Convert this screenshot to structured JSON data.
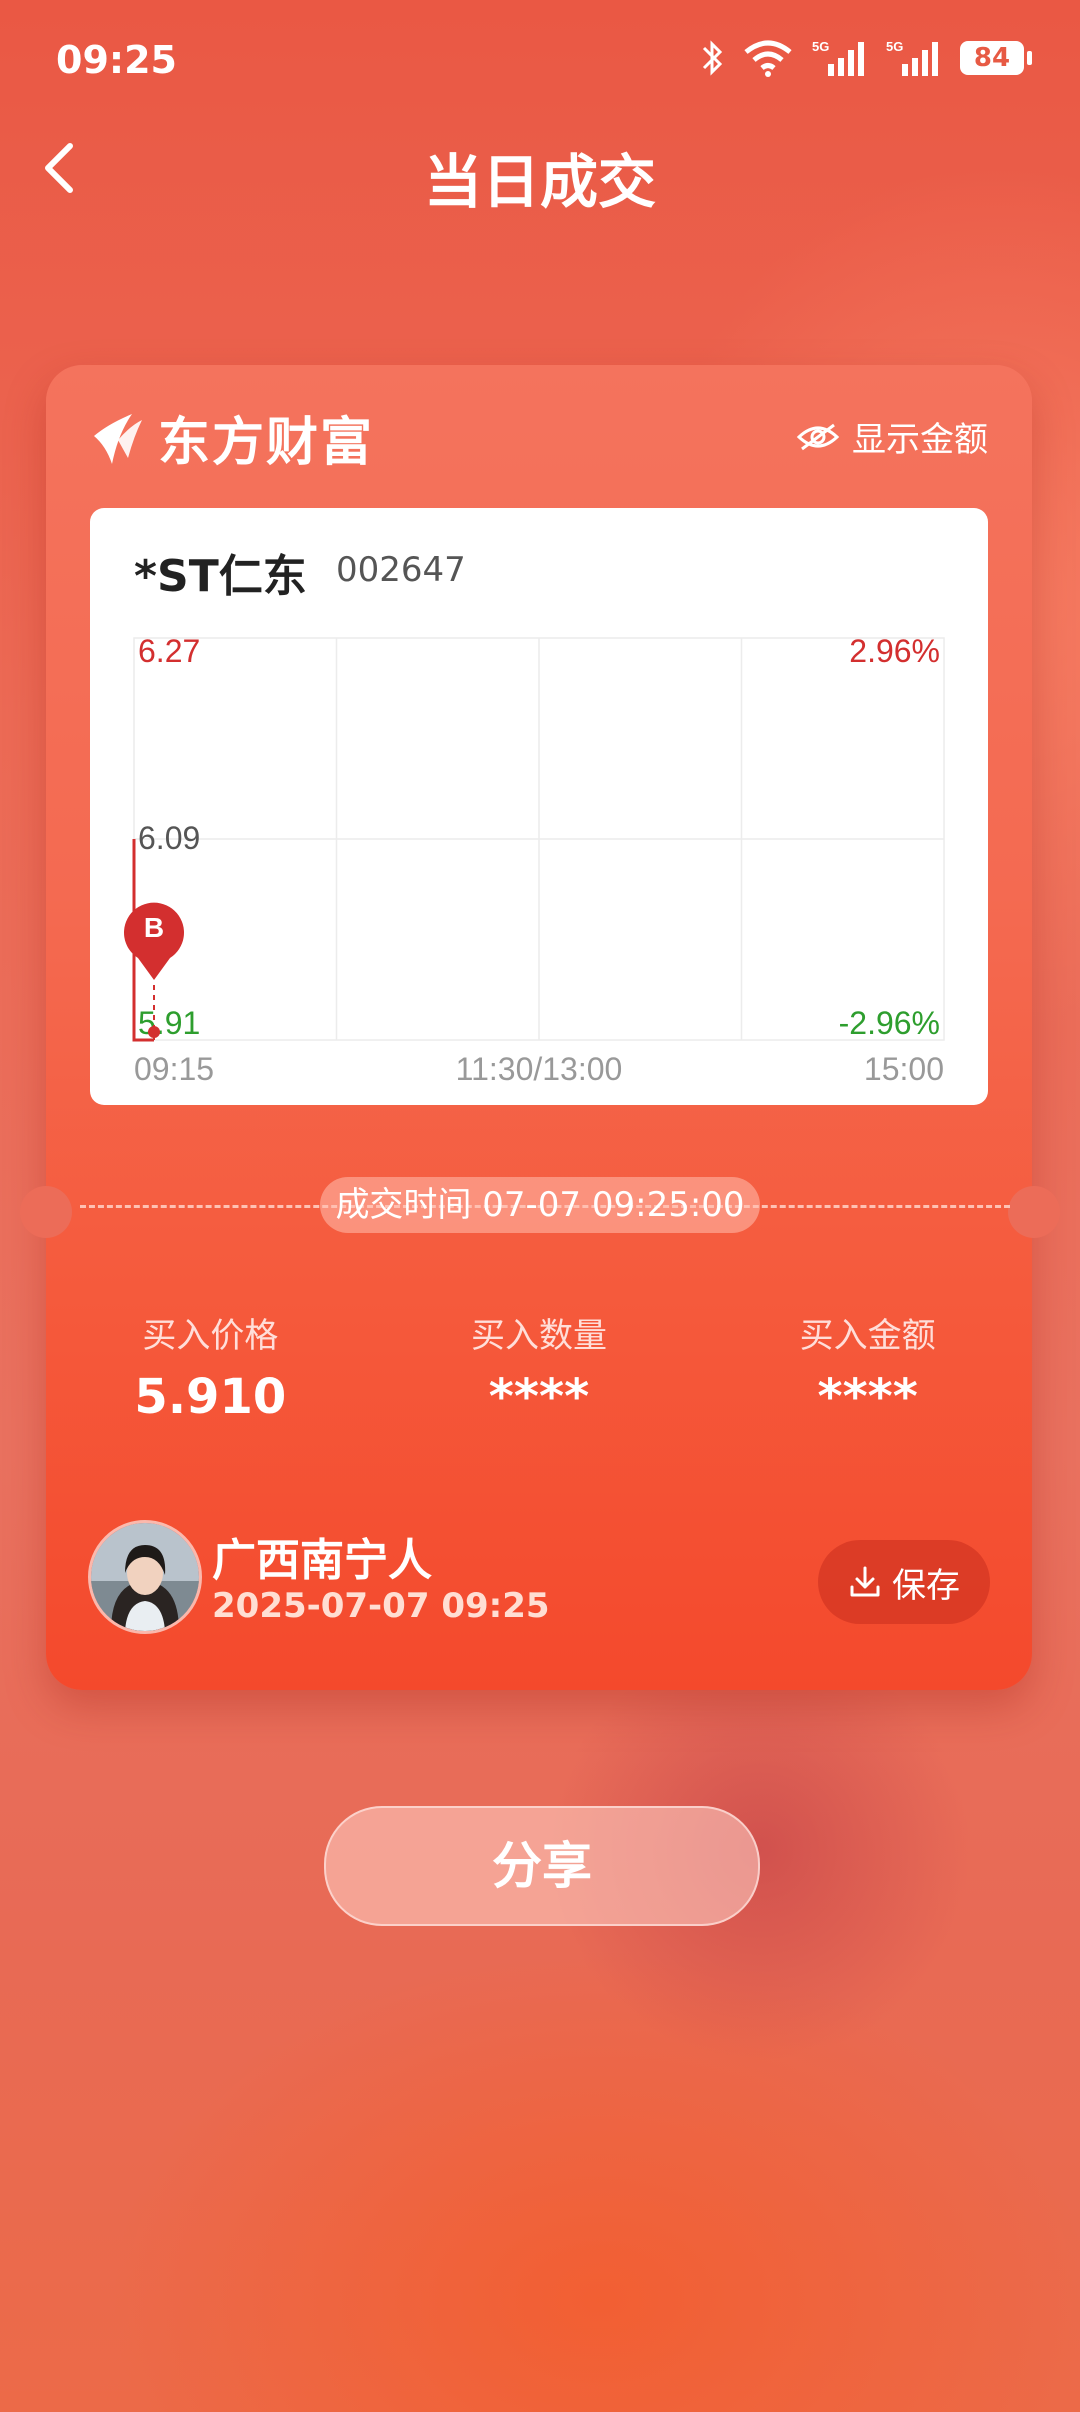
{
  "status_bar": {
    "time": "09:25",
    "battery": "84",
    "net1": "5G",
    "net2": "5G"
  },
  "header": {
    "title": "当日成交"
  },
  "card": {
    "brand": "东方财富",
    "show_amount_label": "显示金额",
    "stock": {
      "name": "*ST仁东",
      "code": "002647"
    },
    "deal_time_label": "成交时间 07-07 09:25:00",
    "stats": [
      {
        "label": "买入价格",
        "value": "5.910"
      },
      {
        "label": "买入数量",
        "value": "****"
      },
      {
        "label": "买入金额",
        "value": "****"
      }
    ],
    "user": {
      "name": "广西南宁人",
      "date": "2025-07-07 09:25"
    },
    "save_label": "保存"
  },
  "share_label": "分享",
  "colors": {
    "up": "#d32f2f",
    "down": "#2e9e2e",
    "accent": "#e8452c"
  },
  "chart_data": {
    "type": "line",
    "x_ticks": [
      "09:15",
      "11:30/13:00",
      "15:00"
    ],
    "y_ticks_left": [
      "6.27",
      "6.09",
      "5.91"
    ],
    "y_ticks_right": [
      "2.96%",
      "-2.96%"
    ],
    "ylim": [
      5.91,
      6.27
    ],
    "series": [
      {
        "x": [
          "09:15",
          "09:15",
          "09:25"
        ],
        "values": [
          6.09,
          5.91,
          5.91
        ]
      }
    ],
    "marker": {
      "label": "B",
      "time": "09:25",
      "value": 5.91
    },
    "grid": true
  }
}
